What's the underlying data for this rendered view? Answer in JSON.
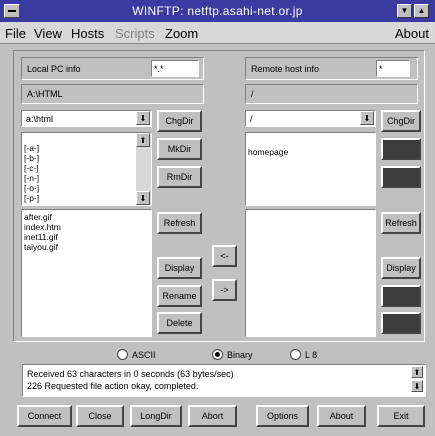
{
  "window": {
    "title": "WINFTP: netftp.asahi-net.or.jp"
  },
  "menu": {
    "items": [
      "File",
      "View",
      "Hosts",
      "Scripts",
      "Zoom"
    ],
    "about": "About"
  },
  "local": {
    "info_label": "Local PC info",
    "info_value": "*.*",
    "path": "A:\\HTML",
    "dir_combo": "a:\\html",
    "drives": [
      "[-a-]",
      "[-b-]",
      "[-c-]",
      "[-n-]",
      "[-o-]",
      "[-p-]",
      "[-q-]"
    ],
    "files": [
      "after.gif",
      "index.htm",
      "inet11.gif",
      "taiyou.gif"
    ],
    "buttons": {
      "chgdir": "ChgDir",
      "mkdir": "MkDir",
      "rmdir": "RmDir",
      "refresh": "Refresh",
      "display": "Display",
      "rename": "Rename",
      "delete": "Delete"
    }
  },
  "remote": {
    "info_label": "Remote host info",
    "info_value": "*",
    "path": "/",
    "dir_combo": "/",
    "dirs": [
      "homepage"
    ],
    "buttons": {
      "chgdir": "ChgDir",
      "refresh": "Refresh",
      "display": "Display"
    }
  },
  "transfer": {
    "to_local": "<-",
    "to_remote": "->"
  },
  "mode": {
    "options": [
      "ASCII",
      "Binary",
      "L 8"
    ],
    "selected": "Binary"
  },
  "status": {
    "lines": [
      "Received 63 characters in 0 seconds (63 bytes/sec)",
      "226 Requested file action okay, completed."
    ]
  },
  "bottom_buttons": [
    "Connect",
    "Close",
    "LongDir",
    "Abort",
    "Options",
    "About",
    "Exit"
  ]
}
